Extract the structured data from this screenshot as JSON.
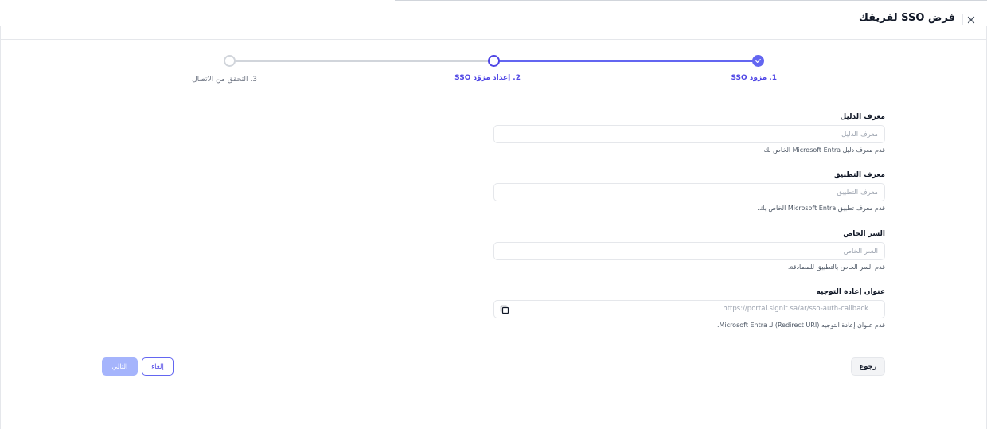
{
  "header": {
    "title": "فرض SSO لفريقك",
    "close_icon": "close-icon"
  },
  "stepper": {
    "steps": [
      {
        "label": "1. مزود SSO",
        "state": "completed"
      },
      {
        "label": "2. إعداد مزوّد SSO",
        "state": "current"
      },
      {
        "label": "3. التحقق من الاتصال",
        "state": "pending"
      }
    ],
    "active_color": "#6366f1",
    "inactive_color": "#d1d5db"
  },
  "form": {
    "directory_id": {
      "label": "معرف الدليل",
      "placeholder": "معرف الدليل",
      "value": "",
      "help": "قدم معرف دليل Microsoft Entra الخاص بك."
    },
    "application_id": {
      "label": "معرف التطبيق",
      "placeholder": "معرف التطبيق",
      "value": "",
      "help": "قدم معرف تطبيق Microsoft Entra الخاص بك."
    },
    "client_secret": {
      "label": "السر الخاص",
      "placeholder": "السر الخاص",
      "value": "",
      "help": "قدم السر الخاص بالتطبيق للمصادقة."
    },
    "redirect_url": {
      "label": "عنوان إعادة التوجيه",
      "value": "https://portal.signit.sa/ar/sso-auth-callback",
      "copy_icon": "copy-icon",
      "help": "قدم عنوان إعادة التوجيه (Redirect URI) لـ Microsoft Entra."
    }
  },
  "actions": {
    "back_label": "رجوع",
    "cancel_label": "إلغاء",
    "next_label": "التالي",
    "next_disabled": true
  }
}
